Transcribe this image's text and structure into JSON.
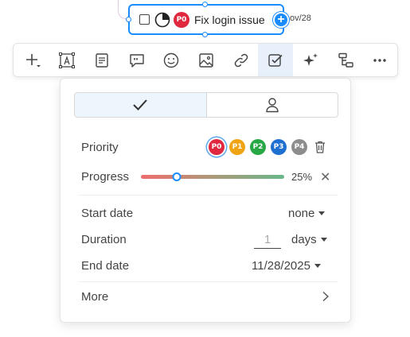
{
  "node": {
    "priority": "P0",
    "title": "Fix login issue",
    "date_fragment": "ov/28",
    "progress_fraction": 0.25
  },
  "toolbar": {
    "items": [
      {
        "name": "add-icon"
      },
      {
        "name": "text-box-icon"
      },
      {
        "name": "note-icon"
      },
      {
        "name": "callout-icon"
      },
      {
        "name": "emoji-icon"
      },
      {
        "name": "image-icon"
      },
      {
        "name": "link-icon"
      },
      {
        "name": "task-icon",
        "active": true
      },
      {
        "name": "sparkle-icon"
      },
      {
        "name": "structure-icon"
      },
      {
        "name": "more-icon"
      }
    ]
  },
  "panel": {
    "tabs": [
      {
        "name": "check-icon",
        "active": true
      },
      {
        "name": "person-icon",
        "active": false
      }
    ],
    "priority_label": "Priority",
    "priorities": [
      {
        "label": "P0",
        "color": "#e0283e",
        "selected": true
      },
      {
        "label": "P1",
        "color": "#f0a413"
      },
      {
        "label": "P2",
        "color": "#28a745"
      },
      {
        "label": "P3",
        "color": "#1f6fd1"
      },
      {
        "label": "P4",
        "color": "#8d8d8d"
      }
    ],
    "progress_label": "Progress",
    "progress_value": 25,
    "progress_text": "25%",
    "clear_symbol": "✕",
    "start_date_label": "Start date",
    "start_date_value": "none",
    "duration_label": "Duration",
    "duration_placeholder": "1",
    "duration_unit": "days",
    "end_date_label": "End date",
    "end_date_value": "11/28/2025",
    "more_label": "More"
  },
  "colors": {
    "accent": "#1a8cff",
    "p0": "#e0283e"
  }
}
